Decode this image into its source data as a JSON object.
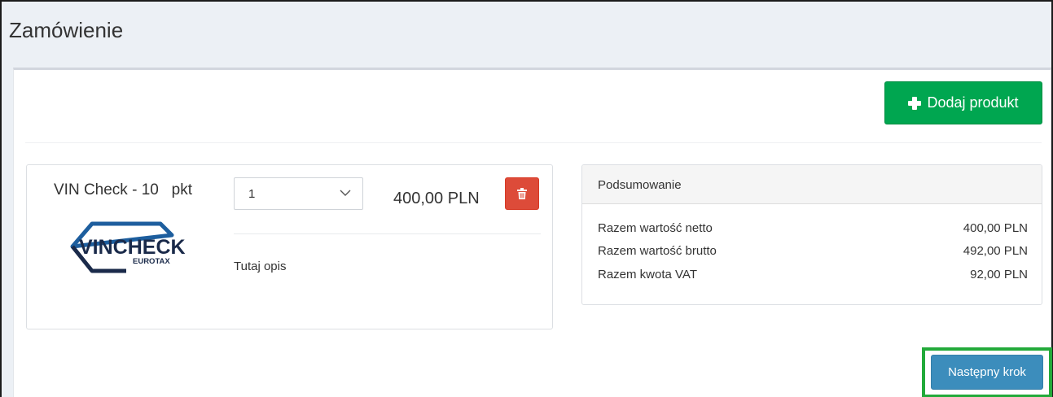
{
  "page": {
    "title": "Zamówienie"
  },
  "toolbar": {
    "add_product_label": "Dodaj produkt"
  },
  "product": {
    "name": "VIN Check - 10   pkt",
    "quantity": "1",
    "price": "400,00 PLN",
    "description": "Tutaj opis",
    "logo": {
      "main_text": "VINCHECK",
      "sub_text": "EUROTAX"
    }
  },
  "summary": {
    "title": "Podsumowanie",
    "rows": [
      {
        "label": "Razem wartość netto",
        "value": "400,00 PLN"
      },
      {
        "label": "Razem wartość brutto",
        "value": "492,00 PLN"
      },
      {
        "label": "Razem kwota VAT",
        "value": "92,00 PLN"
      }
    ]
  },
  "footer": {
    "next_step_label": "Następny krok"
  },
  "colors": {
    "add_button": "#00a650",
    "delete_button": "#dd4b39",
    "next_button": "#3c8dbc",
    "highlight": "#22aa3a",
    "logo_blue": "#1d5e9e",
    "logo_dark": "#1a2a4a"
  },
  "icons": {
    "add": "plus-icon",
    "delete": "trash-icon",
    "select": "chevron-down-icon"
  }
}
